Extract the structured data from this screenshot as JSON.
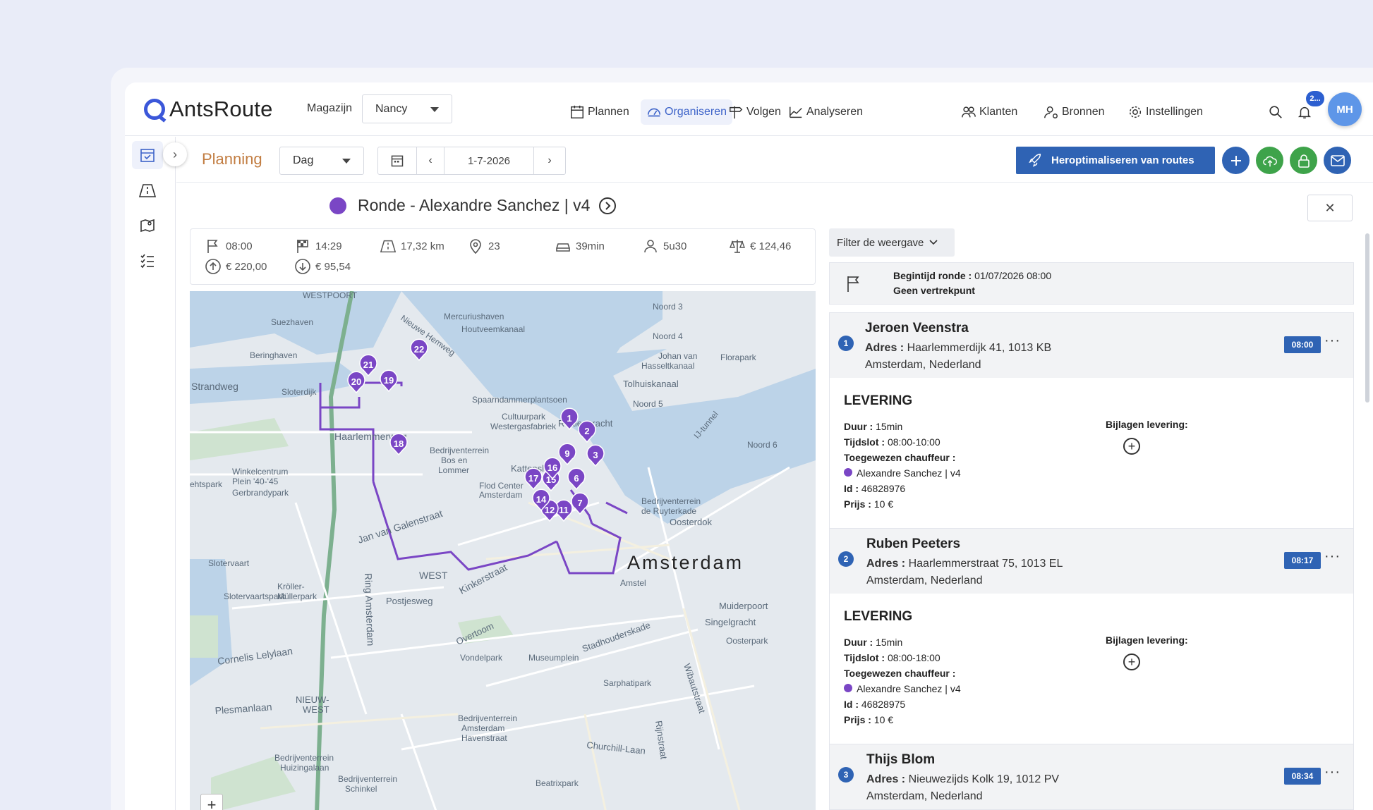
{
  "brand": {
    "name": "AntsRoute"
  },
  "header": {
    "warehouse_label": "Magazijn",
    "warehouse_value": "Nancy",
    "nav": [
      {
        "label": "Plannen",
        "icon": "calendar-icon"
      },
      {
        "label": "Organiseren",
        "icon": "dashboard-icon",
        "active": true
      },
      {
        "label": "Volgen",
        "icon": "signpost-icon"
      },
      {
        "label": "Analyseren",
        "icon": "chart-icon"
      }
    ],
    "right_nav": [
      {
        "label": "Klanten",
        "icon": "users-icon"
      },
      {
        "label": "Bronnen",
        "icon": "user-gear-icon"
      },
      {
        "label": "Instellingen",
        "icon": "gear-icon"
      }
    ],
    "notification_badge": "2...",
    "avatar_initials": "MH"
  },
  "toolbar": {
    "title": "Planning",
    "view_value": "Dag",
    "date": "1-7-2026",
    "reoptimize_label": "Heroptimaliseren van routes",
    "accent": "#2f63b4"
  },
  "route": {
    "title": "Ronde - Alexandre Sanchez | v4",
    "color": "#7a46c5",
    "stats": {
      "start": "08:00",
      "end": "14:29",
      "distance": "17,32 km",
      "stops": "23",
      "drive_time": "39min",
      "work_time": "5u30",
      "cost": "€ 124,46",
      "revenue": "€ 220,00",
      "expense": "€ 95,54"
    }
  },
  "panel": {
    "filter_label": "Filter de weergave",
    "start_label": "Begintijd ronde :",
    "start_value": "01/07/2026 08:00",
    "no_depot": "Geen vertrekpunt",
    "labels": {
      "address": "Adres :",
      "duration": "Duur :",
      "slot": "Tijdslot :",
      "driver": "Toegewezen chauffeur :",
      "id": "Id :",
      "price": "Prijs :",
      "attachments": "Bijlagen levering:",
      "delivery": "LEVERING"
    },
    "stops": [
      {
        "num": "1",
        "name": "Jeroen Veenstra",
        "addr1": "Haarlemmerdijk 41, 1013 KB",
        "addr2": "Amsterdam, Nederland",
        "time": "08:00",
        "duration": "15min",
        "slot": "08:00-10:00",
        "driver": "Alexandre Sanchez | v4",
        "id": "46828976",
        "price": "10 €"
      },
      {
        "num": "2",
        "name": "Ruben Peeters",
        "addr1": "Haarlemmerstraat 75, 1013 EL",
        "addr2": "Amsterdam, Nederland",
        "time": "08:17",
        "duration": "15min",
        "slot": "08:00-18:00",
        "driver": "Alexandre Sanchez | v4",
        "id": "46828975",
        "price": "10 €"
      },
      {
        "num": "3",
        "name": "Thijs Blom",
        "addr1": "Nieuwezijds Kolk 19, 1012 PV",
        "addr2": "Amsterdam, Nederland",
        "time": "08:34"
      }
    ]
  },
  "map": {
    "city_label": "Amsterdam",
    "labels": [
      "WESTPOORT",
      "Suezhaven",
      "Beringhaven",
      "Mercuriushaven",
      "Houtveemkanaal",
      "Nieuwe Hemweg",
      "Spaarndammerplantsoen",
      "Cultuurpark Westergasfabriek",
      "Haarlemmerweg",
      "Sloterdijk",
      "Bedrijventerrein Bos en Lommer",
      "Gerbrandypark",
      "Winkelcentrum Plein '40-'45",
      "Kattenslot",
      "Flod Center Amsterdam",
      "Realengracht",
      "Tolhuiskanaal",
      "Noord 3",
      "Noord 4",
      "Noord 5",
      "Noord 6",
      "Florapark",
      "Johan van Hasseltkanaal",
      "IJ-tunnel",
      "Oosterdok",
      "Bedrijventerrein de Ruyterkade",
      "Jan van Galenstraat",
      "WEST",
      "Kinkerstraat",
      "Postjesweg",
      "Overtoom",
      "Vondelpark",
      "Museumplein",
      "Stadhouderskade",
      "Sarphatipark",
      "Muiderpoort",
      "Singelgracht",
      "Oosterpark",
      "Slotervaart",
      "Kröller-Müllerpark",
      "Slotervaartspark",
      "Ring Amsterdam",
      "Cornelis Lelylaan",
      "Plesmanlaan",
      "NIEUW-WEST",
      "Churchill-Laan",
      "Beatrixpark",
      "Amstel",
      "Wibautstraat",
      "Rijnstraat",
      "Bedrijventerrein Amsterdam Havenstraat",
      "Bedrijventerrein Huizingalaan",
      "Bedrijventerrein Schinkel"
    ],
    "markers": [
      "1",
      "2",
      "3",
      "6",
      "7",
      "9",
      "11",
      "12",
      "14",
      "15",
      "16",
      "17",
      "18",
      "19",
      "20",
      "21",
      "22"
    ]
  }
}
